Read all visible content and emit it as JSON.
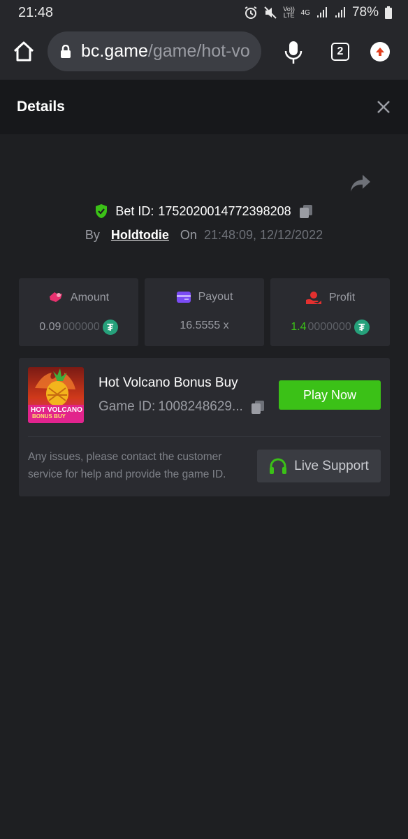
{
  "status_bar": {
    "time": "21:48",
    "battery": "78%",
    "network_icons": [
      "alarm-icon",
      "mute-icon",
      "volte-icon",
      "4g-icon",
      "signal-icon",
      "signal-icon",
      "battery-icon"
    ],
    "volte_label": "Vo)) LTE",
    "network_label": "4G"
  },
  "browser": {
    "url_domain": "bc.game",
    "url_path": "/game/hot-vo",
    "tab_count": "2"
  },
  "details": {
    "title": "Details"
  },
  "bet": {
    "bet_id_label": "Bet ID:",
    "bet_id": "1752020014772398208",
    "by_label": "By",
    "username": "Holdtodie",
    "on_label": "On",
    "timestamp": "21:48:09, 12/12/2022"
  },
  "stats": {
    "amount": {
      "label": "Amount",
      "value_main": "0.09",
      "value_dim": "000000"
    },
    "payout": {
      "label": "Payout",
      "value": "16.5555 x"
    },
    "profit": {
      "label": "Profit",
      "value_main": "1.4",
      "value_dim": "0000000"
    }
  },
  "game": {
    "name": "Hot Volcano Bonus Buy",
    "thumb_line1": "HOT VOLCANO",
    "thumb_line2": "BONUS BUY",
    "game_id_label": "Game ID:",
    "game_id": "1008248629...",
    "play_label": "Play Now",
    "help_text": "Any issues, please contact the customer service for help and provide the game ID.",
    "support_label": "Live Support"
  },
  "colors": {
    "accent_green": "#3bc117",
    "tether_green": "#26a17b",
    "amount_icon": "#e8316f",
    "payout_icon": "#7b4cf5",
    "profit_icon": "#e3302f"
  }
}
